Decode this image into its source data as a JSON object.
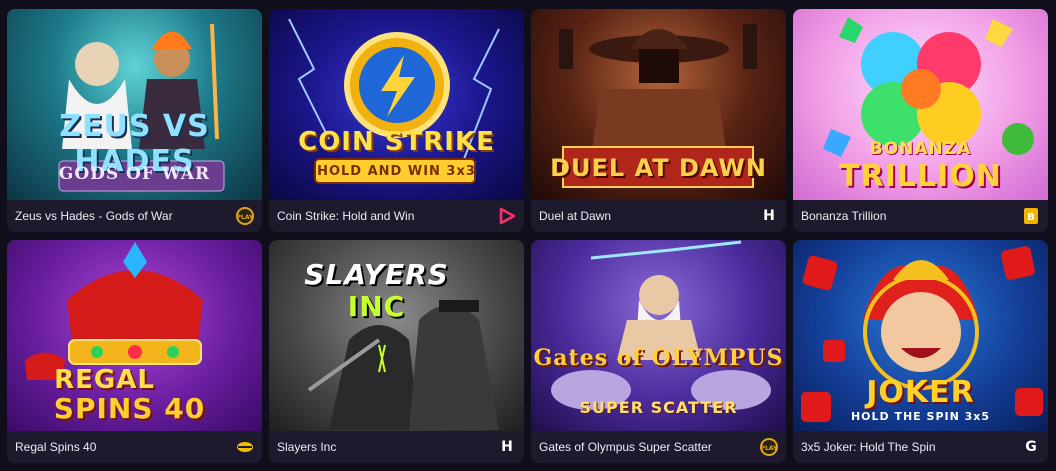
{
  "games": [
    {
      "title": "Zeus vs Hades - Gods of War",
      "logo": "ZEUS VS HADES",
      "logo_sub": "GODS OF WAR",
      "provider_icon": "play-n-go-icon"
    },
    {
      "title": "Coin Strike: Hold and Win",
      "logo": "COIN STRIKE",
      "logo_sub": "HOLD AND WIN 3x3",
      "provider_icon": "playson-icon"
    },
    {
      "title": "Duel at Dawn",
      "logo": "DUEL AT DAWN",
      "logo_sub": "",
      "provider_icon": "hacksaw-icon"
    },
    {
      "title": "Bonanza Trillion",
      "logo": "BONANZA",
      "logo_sub": "TRILLION",
      "provider_icon": "bgaming-icon"
    },
    {
      "title": "Regal Spins 40",
      "logo": "REGAL",
      "logo_sub": "SPINS 40",
      "provider_icon": "endorphina-icon"
    },
    {
      "title": "Slayers Inc",
      "logo": "SLAYERS",
      "logo_sub": "INC",
      "provider_icon": "hacksaw-icon"
    },
    {
      "title": "Gates of Olympus Super Scatter",
      "logo": "Gates of OLYMPUS",
      "logo_sub": "SUPER SCATTER",
      "provider_icon": "pragmatic-play-icon"
    },
    {
      "title": "3x5 Joker: Hold The Spin",
      "logo": "JOKER",
      "logo_sub": "HOLD THE SPIN 3x5",
      "provider_icon": "gamzix-icon"
    }
  ],
  "colors": {
    "background": "#0f0e1a",
    "card": "#1c1a2c",
    "text": "#eeeaf6"
  }
}
